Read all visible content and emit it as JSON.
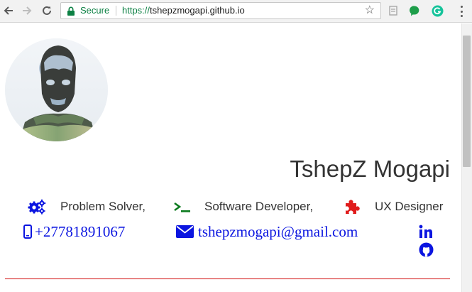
{
  "browser": {
    "secure_label": "Secure",
    "url_scheme": "https://",
    "url_host": "tshepzmogapi.github.io"
  },
  "profile": {
    "name": "TshepZ Mogapi",
    "roles": [
      {
        "label": "Problem Solver,",
        "icon": "gears-icon",
        "color": "#0b15e0"
      },
      {
        "label": "Software Developer,",
        "icon": "terminal-icon",
        "color": "#0b7a1e"
      },
      {
        "label": "UX Designer",
        "icon": "puzzle-icon",
        "color": "#e01b1b"
      }
    ],
    "phone": "+27781891067",
    "email": "tshepzmogapi@gmail.com",
    "social": [
      "linkedin-icon",
      "github-icon"
    ]
  },
  "colors": {
    "accent": "#0b15e0",
    "divider": "#d10b0b",
    "secure_green": "#0b8043"
  }
}
